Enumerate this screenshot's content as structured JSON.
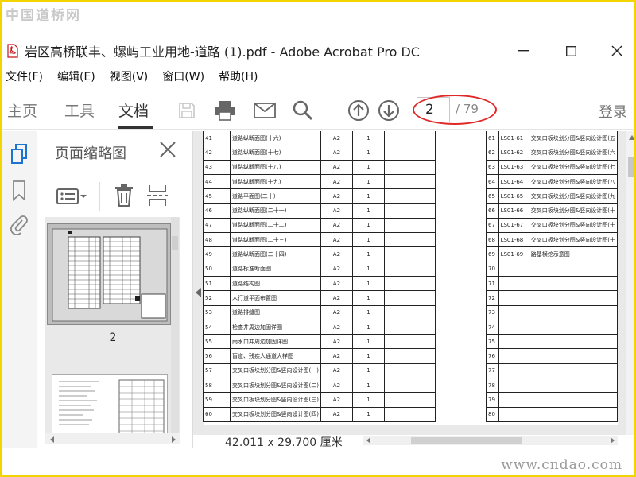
{
  "watermark": {
    "top": "中国道桥网",
    "bottom": "www.cndao.com"
  },
  "window": {
    "title": "岩区高桥联丰、螺屿工业用地-道路 (1).pdf - Adobe Acrobat Pro DC",
    "minimize_glyph": "—",
    "maximize_glyph": "☐",
    "close_glyph": "✕"
  },
  "menu": [
    "文件(F)",
    "编辑(E)",
    "视图(V)",
    "窗口(W)",
    "帮助(H)"
  ],
  "tabs": [
    "主页",
    "工具",
    "文档"
  ],
  "active_tab": "文档",
  "toolbar": {
    "current_page": "2",
    "total_pages": "/ 79",
    "login": "登录",
    "icons": [
      "save-icon",
      "print-icon",
      "email-icon",
      "search-icon",
      "page-up-icon",
      "page-down-icon"
    ]
  },
  "sidebar": {
    "title": "页面缩略图",
    "thumbnail_label": "2",
    "icons": [
      "pages-icon",
      "bookmark-icon",
      "attachment-icon"
    ]
  },
  "status": {
    "size": "42.011 x 29.700 厘米"
  },
  "colors": {
    "highlight": "#e12828",
    "frame": "#f2d400"
  },
  "table_left": [
    [
      "41",
      "道路纵断面图(十六)",
      "A2",
      "1",
      ""
    ],
    [
      "42",
      "道路纵断面图(十七)",
      "A2",
      "1",
      ""
    ],
    [
      "43",
      "道路纵断面图(十八)",
      "A2",
      "1",
      ""
    ],
    [
      "44",
      "道路纵断面图(十九)",
      "A2",
      "1",
      ""
    ],
    [
      "45",
      "道路平面图(二十)",
      "A2",
      "1",
      ""
    ],
    [
      "46",
      "道路纵断面图(二十一)",
      "A2",
      "1",
      ""
    ],
    [
      "47",
      "道路纵断面图(二十二)",
      "A2",
      "1",
      ""
    ],
    [
      "48",
      "道路纵断面图(二十三)",
      "A2",
      "1",
      ""
    ],
    [
      "49",
      "道路纵断面图(二十四)",
      "A2",
      "1",
      ""
    ],
    [
      "50",
      "道路标准断面图",
      "A2",
      "1",
      ""
    ],
    [
      "51",
      "道路结构图",
      "A2",
      "1",
      ""
    ],
    [
      "52",
      "人行道平面布置图",
      "A2",
      "1",
      ""
    ],
    [
      "53",
      "道路排缝图",
      "A2",
      "1",
      ""
    ],
    [
      "54",
      "检查井周边加固详图",
      "A2",
      "1",
      ""
    ],
    [
      "55",
      "雨水口井周边加固详图",
      "A2",
      "1",
      ""
    ],
    [
      "56",
      "盲道、残疾人通道大样图",
      "A2",
      "1",
      ""
    ],
    [
      "57",
      "交叉口板块划分图&竖向设计图(一)",
      "A2",
      "1",
      ""
    ],
    [
      "58",
      "交叉口板块划分图&竖向设计图(二)",
      "A2",
      "1",
      ""
    ],
    [
      "59",
      "交叉口板块划分图&竖向设计图(三)",
      "A2",
      "1",
      ""
    ],
    [
      "60",
      "交叉口板块划分图&竖向设计图(四)",
      "A2",
      "1",
      ""
    ]
  ],
  "table_right": [
    [
      "61",
      "LS01-61",
      "交叉口板块划分图&竖向设计图(五"
    ],
    [
      "62",
      "LS01-62",
      "交叉口板块划分图&竖向设计图(六"
    ],
    [
      "63",
      "LS01-63",
      "交叉口板块划分图&竖向设计图(七"
    ],
    [
      "64",
      "LS01-64",
      "交叉口板块划分图&竖向设计图(八"
    ],
    [
      "65",
      "LS01-65",
      "交叉口板块划分图&竖向设计图(九"
    ],
    [
      "66",
      "LS01-66",
      "交叉口板块划分图&竖向设计图(十"
    ],
    [
      "67",
      "LS01-67",
      "交叉口板块划分图&竖向设计图(十"
    ],
    [
      "68",
      "LS01-68",
      "交叉口板块划分图&竖向设计图(十"
    ],
    [
      "69",
      "LS01-69",
      "路基横挖示意图"
    ],
    [
      "70",
      "",
      ""
    ],
    [
      "71",
      "",
      ""
    ],
    [
      "72",
      "",
      ""
    ],
    [
      "73",
      "",
      ""
    ],
    [
      "74",
      "",
      ""
    ],
    [
      "75",
      "",
      ""
    ],
    [
      "76",
      "",
      ""
    ],
    [
      "77",
      "",
      ""
    ],
    [
      "78",
      "",
      ""
    ],
    [
      "79",
      "",
      ""
    ],
    [
      "80",
      "",
      ""
    ]
  ]
}
